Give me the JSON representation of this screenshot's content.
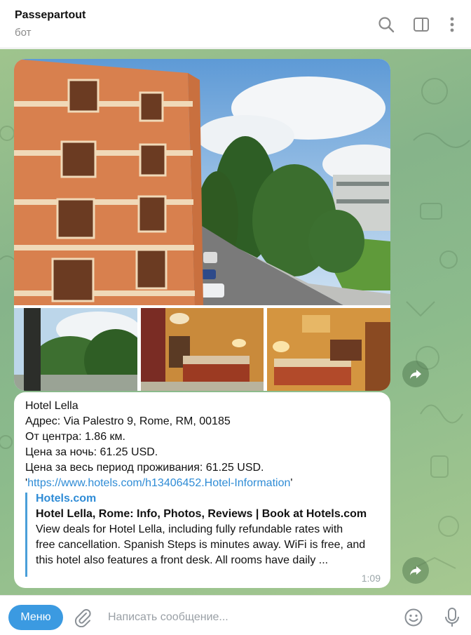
{
  "header": {
    "title": "Passepartout",
    "subtitle": "бот"
  },
  "album": {
    "photos": [
      {
        "name": "hotel-facade-street-view"
      },
      {
        "name": "garden-view"
      },
      {
        "name": "double-room-red"
      },
      {
        "name": "twin-room-orange"
      }
    ]
  },
  "message": {
    "lines": [
      "Hotel Lella",
      "Адрес: Via Palestro 9, Rome, RM, 00185",
      "От центра: 1.86 км.",
      "Цена за ночь: 61.25 USD.",
      "Цена за весь период проживания: 61.25 USD."
    ],
    "link_prefix": "'",
    "link": "https://www.hotels.com/h13406452.Hotel-Information",
    "link_suffix": "'",
    "preview": {
      "site": "Hotels.com",
      "title": "Hotel Lella, Rome: Info, Photos, Reviews | Book at Hotels.com",
      "description": [
        "View deals for Hotel Lella, including fully refundable rates with",
        "free cancellation. Spanish Steps is minutes away. WiFi is free, and",
        "this hotel also features a front desk. All rooms have daily ..."
      ]
    },
    "time": "1:09"
  },
  "input": {
    "menu_label": "Меню",
    "placeholder": "Написать сообщение..."
  },
  "colors": {
    "accent": "#3b9ae1",
    "link": "#2f8cd6",
    "chat_bg": "#8cbb8c"
  }
}
